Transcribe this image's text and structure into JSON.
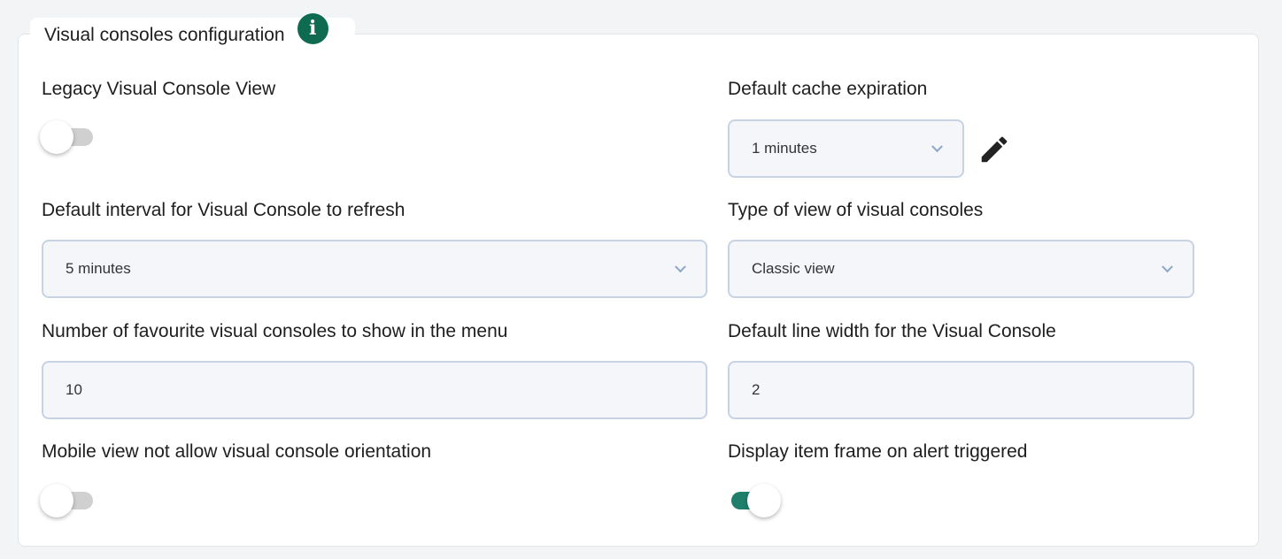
{
  "section": {
    "title": "Visual consoles configuration",
    "info_icon": "info-icon"
  },
  "fields": {
    "legacy_view": {
      "label": "Legacy Visual Console View",
      "enabled": false
    },
    "cache_expiration": {
      "label": "Default cache expiration",
      "value": "1 minutes",
      "edit_icon": "pencil-icon"
    },
    "refresh_interval": {
      "label": "Default interval for Visual Console to refresh",
      "value": "5 minutes"
    },
    "view_type": {
      "label": "Type of view of visual consoles",
      "value": "Classic view"
    },
    "favourites_count": {
      "label": "Number of favourite visual consoles to show in the menu",
      "value": "10"
    },
    "line_width": {
      "label": "Default line width for the Visual Console",
      "value": "2"
    },
    "mobile_orientation": {
      "label": "Mobile view not allow visual console orientation",
      "enabled": false
    },
    "item_frame_alert": {
      "label": "Display item frame on alert triggered",
      "enabled": true
    }
  },
  "colors": {
    "accent": "#1f7f6a",
    "info_icon": "#0f6b4f",
    "field_border": "#c7d3e3",
    "field_bg": "#f4f6fa"
  }
}
